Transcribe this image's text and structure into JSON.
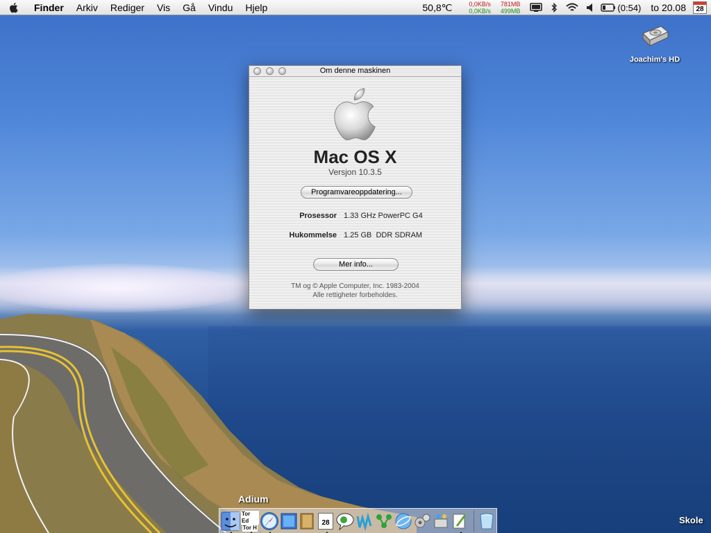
{
  "menubar": {
    "app_name": "Finder",
    "items": [
      "Arkiv",
      "Rediger",
      "Vis",
      "Gå",
      "Vindu",
      "Hjelp"
    ],
    "temperature": "50,8℃",
    "net_up": "0,0KB/s",
    "net_down": "0,0KB/s",
    "mem_used": "781MB",
    "mem_free": "499MB",
    "battery": "(0:54)",
    "clock": "to 20.08",
    "calendar_day": "28"
  },
  "desktop": {
    "hd_label": "Joachim's HD",
    "corner_label": "Skole"
  },
  "about_window": {
    "title": "Om denne maskinen",
    "os_name": "Mac OS X",
    "version": "Versjon 10.3.5",
    "update_button": "Programvareoppdatering...",
    "processor_label": "Prosessor",
    "processor_value": "1.33 GHz PowerPC G4",
    "memory_label": "Hukommelse",
    "memory_value": "1.25 GB  DDR SDRAM",
    "more_info_button": "Mer info...",
    "copyright_line1": "TM og © Apple Computer, Inc. 1983-2004",
    "copyright_line2": "Alle rettigheter forbeholdes."
  },
  "dock": {
    "hover_label": "Adium",
    "items": [
      {
        "name": "finder-icon"
      },
      {
        "name": "address-book-icon",
        "text1": "Tor Ed",
        "text2": "Tor H"
      },
      {
        "name": "safari-icon"
      },
      {
        "name": "preview-icon"
      },
      {
        "name": "notebook-icon"
      },
      {
        "name": "ical-icon",
        "text": "28"
      },
      {
        "name": "adium-icon"
      },
      {
        "name": "music-icon"
      },
      {
        "name": "network-icon"
      },
      {
        "name": "globe-icon"
      },
      {
        "name": "gears-icon"
      },
      {
        "name": "server-icon"
      },
      {
        "name": "script-editor-icon"
      },
      {
        "name": "trash-icon"
      }
    ]
  }
}
